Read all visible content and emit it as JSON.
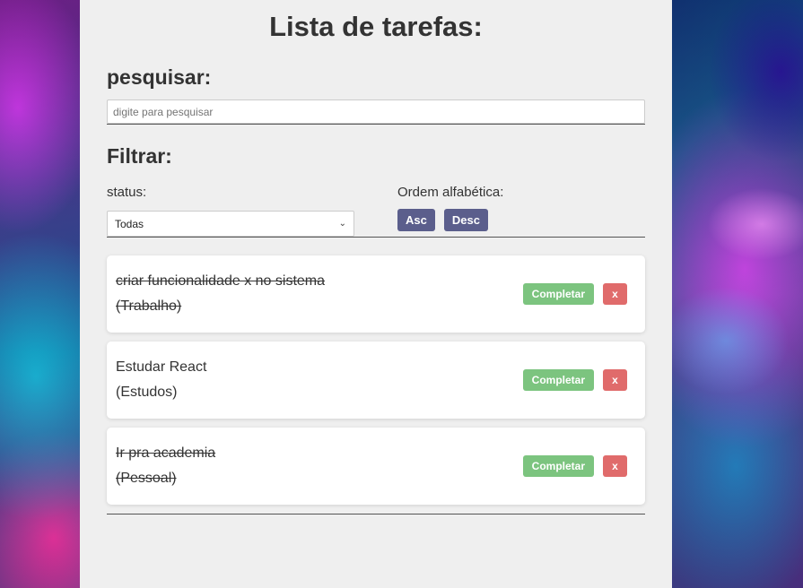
{
  "title": "Lista de tarefas:",
  "search": {
    "heading": "pesquisar:",
    "placeholder": "digite para pesquisar",
    "value": ""
  },
  "filter": {
    "heading": "Filtrar:",
    "status_label": "status:",
    "status_selected": "Todas",
    "order_label": "Ordem alfabética:",
    "asc_label": "Asc",
    "desc_label": "Desc"
  },
  "todos": [
    {
      "text": "criar funcionalidade x no sistema",
      "category": "(Trabalho)",
      "completed": true,
      "complete_label": "Completar",
      "remove_label": "x"
    },
    {
      "text": "Estudar React",
      "category": "(Estudos)",
      "completed": false,
      "complete_label": "Completar",
      "remove_label": "x"
    },
    {
      "text": "Ir pra academia",
      "category": "(Pessoal)",
      "completed": true,
      "complete_label": "Completar",
      "remove_label": "x"
    }
  ],
  "colors": {
    "sort_button": "#5b5e8c",
    "complete_button": "#7cc47f",
    "remove_button": "#e06b6b",
    "panel_bg": "#efefef"
  }
}
